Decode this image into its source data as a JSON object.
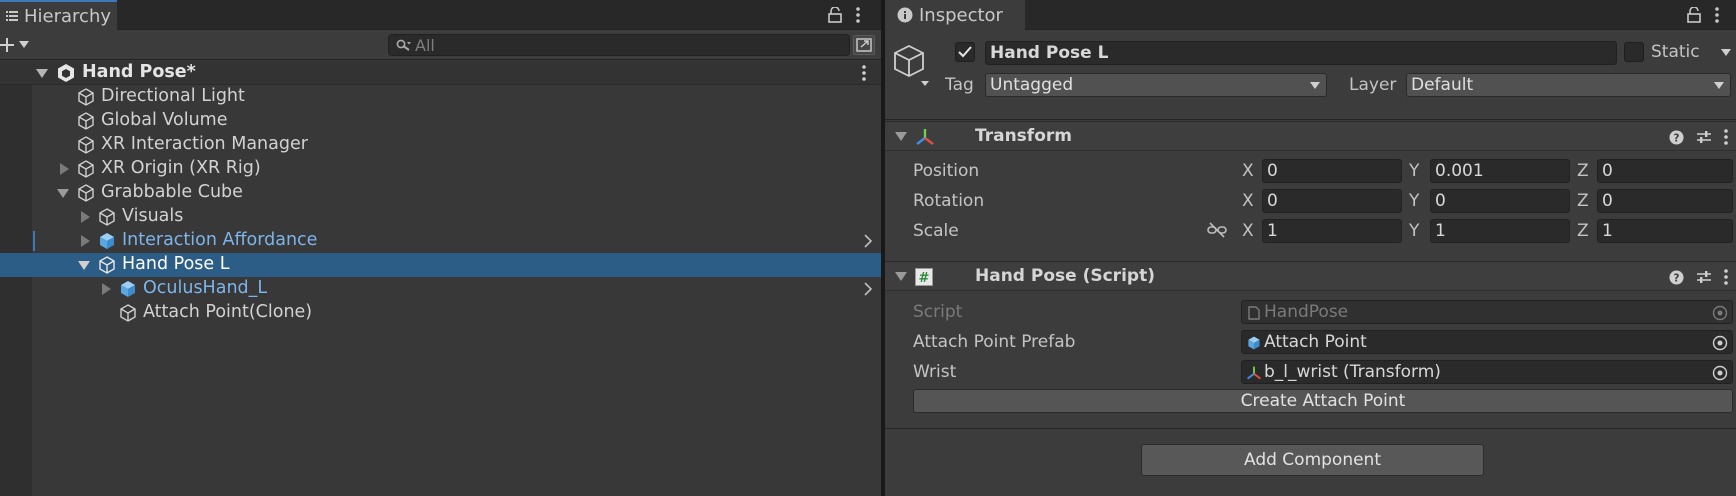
{
  "hierarchy": {
    "tab_label": "Hierarchy",
    "search_placeholder": "All",
    "scene_name": "Hand Pose*",
    "items": [
      {
        "label": "Directional Light"
      },
      {
        "label": "Global Volume"
      },
      {
        "label": "XR Interaction Manager"
      },
      {
        "label": "XR Origin (XR Rig)"
      },
      {
        "label": "Grabbable Cube"
      },
      {
        "label": "Visuals"
      },
      {
        "label": "Interaction Affordance"
      },
      {
        "label": "Hand Pose L"
      },
      {
        "label": "OculusHand_L"
      },
      {
        "label": "Attach Point(Clone)"
      }
    ]
  },
  "inspector": {
    "tab_label": "Inspector",
    "object_name": "Hand Pose L",
    "static_label": "Static",
    "tag_label": "Tag",
    "tag_value": "Untagged",
    "layer_label": "Layer",
    "layer_value": "Default",
    "transform": {
      "title": "Transform",
      "position_label": "Position",
      "rotation_label": "Rotation",
      "scale_label": "Scale",
      "axis_x": "X",
      "axis_y": "Y",
      "axis_z": "Z",
      "position": {
        "x": "0",
        "y": "0.001",
        "z": "0"
      },
      "rotation": {
        "x": "0",
        "y": "0",
        "z": "0"
      },
      "scale": {
        "x": "1",
        "y": "1",
        "z": "1"
      }
    },
    "hand_pose_script": {
      "title": "Hand Pose (Script)",
      "script_label": "Script",
      "script_value": "HandPose",
      "attach_point_prefab_label": "Attach Point Prefab",
      "attach_point_prefab_value": "Attach Point",
      "wrist_label": "Wrist",
      "wrist_value": "b_l_wrist (Transform)",
      "create_button": "Create Attach Point"
    },
    "add_component_button": "Add Component"
  },
  "colors": {
    "selection": "#2c5d87",
    "prefab_text": "#7cb5ec",
    "accent": "#3a79bb"
  }
}
